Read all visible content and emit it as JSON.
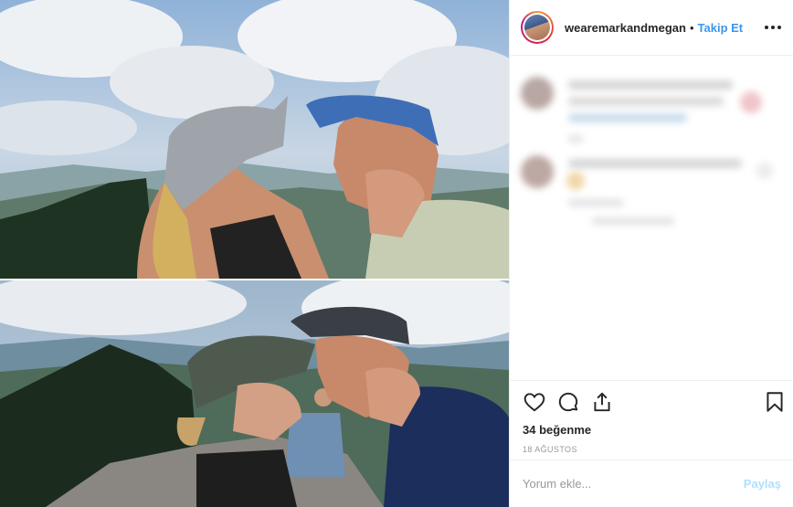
{
  "post": {
    "username": "wearemarkandmegan",
    "separator": "•",
    "follow_label": "Takip Et",
    "likes_text": "34 beğenme",
    "date_text": "18 AĞUSTOS",
    "comment_placeholder": "Yorum ekle...",
    "post_button_label": "Paylaş"
  },
  "icons": {
    "like": "heart-icon",
    "comment": "comment-bubble-icon",
    "share": "share-icon",
    "save": "bookmark-icon",
    "more": "more-options-icon"
  },
  "colors": {
    "accent": "#3897f0",
    "post_disabled": "#b2dffc",
    "text": "#262626",
    "muted": "#999999",
    "border": "#efefef"
  }
}
